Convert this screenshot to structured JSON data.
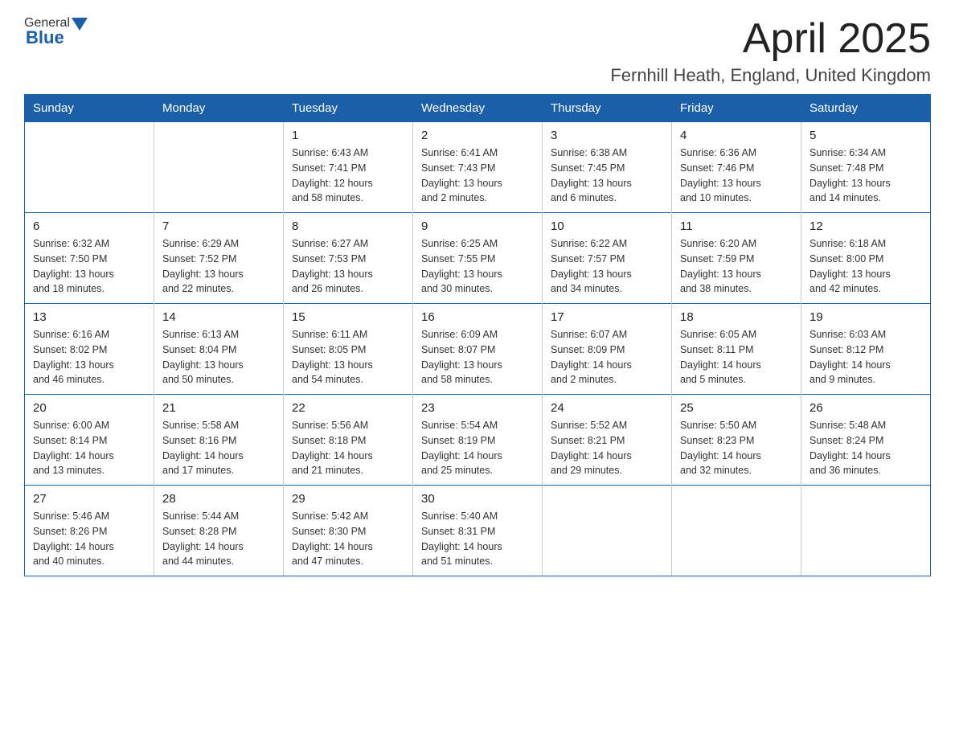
{
  "header": {
    "logo_general": "General",
    "logo_blue": "Blue",
    "month_title": "April 2025",
    "location": "Fernhill Heath, England, United Kingdom"
  },
  "weekdays": [
    "Sunday",
    "Monday",
    "Tuesday",
    "Wednesday",
    "Thursday",
    "Friday",
    "Saturday"
  ],
  "weeks": [
    [
      {
        "day": "",
        "sunrise": "",
        "sunset": "",
        "daylight": ""
      },
      {
        "day": "",
        "sunrise": "",
        "sunset": "",
        "daylight": ""
      },
      {
        "day": "1",
        "sunrise": "Sunrise: 6:43 AM",
        "sunset": "Sunset: 7:41 PM",
        "daylight": "Daylight: 12 hours and 58 minutes."
      },
      {
        "day": "2",
        "sunrise": "Sunrise: 6:41 AM",
        "sunset": "Sunset: 7:43 PM",
        "daylight": "Daylight: 13 hours and 2 minutes."
      },
      {
        "day": "3",
        "sunrise": "Sunrise: 6:38 AM",
        "sunset": "Sunset: 7:45 PM",
        "daylight": "Daylight: 13 hours and 6 minutes."
      },
      {
        "day": "4",
        "sunrise": "Sunrise: 6:36 AM",
        "sunset": "Sunset: 7:46 PM",
        "daylight": "Daylight: 13 hours and 10 minutes."
      },
      {
        "day": "5",
        "sunrise": "Sunrise: 6:34 AM",
        "sunset": "Sunset: 7:48 PM",
        "daylight": "Daylight: 13 hours and 14 minutes."
      }
    ],
    [
      {
        "day": "6",
        "sunrise": "Sunrise: 6:32 AM",
        "sunset": "Sunset: 7:50 PM",
        "daylight": "Daylight: 13 hours and 18 minutes."
      },
      {
        "day": "7",
        "sunrise": "Sunrise: 6:29 AM",
        "sunset": "Sunset: 7:52 PM",
        "daylight": "Daylight: 13 hours and 22 minutes."
      },
      {
        "day": "8",
        "sunrise": "Sunrise: 6:27 AM",
        "sunset": "Sunset: 7:53 PM",
        "daylight": "Daylight: 13 hours and 26 minutes."
      },
      {
        "day": "9",
        "sunrise": "Sunrise: 6:25 AM",
        "sunset": "Sunset: 7:55 PM",
        "daylight": "Daylight: 13 hours and 30 minutes."
      },
      {
        "day": "10",
        "sunrise": "Sunrise: 6:22 AM",
        "sunset": "Sunset: 7:57 PM",
        "daylight": "Daylight: 13 hours and 34 minutes."
      },
      {
        "day": "11",
        "sunrise": "Sunrise: 6:20 AM",
        "sunset": "Sunset: 7:59 PM",
        "daylight": "Daylight: 13 hours and 38 minutes."
      },
      {
        "day": "12",
        "sunrise": "Sunrise: 6:18 AM",
        "sunset": "Sunset: 8:00 PM",
        "daylight": "Daylight: 13 hours and 42 minutes."
      }
    ],
    [
      {
        "day": "13",
        "sunrise": "Sunrise: 6:16 AM",
        "sunset": "Sunset: 8:02 PM",
        "daylight": "Daylight: 13 hours and 46 minutes."
      },
      {
        "day": "14",
        "sunrise": "Sunrise: 6:13 AM",
        "sunset": "Sunset: 8:04 PM",
        "daylight": "Daylight: 13 hours and 50 minutes."
      },
      {
        "day": "15",
        "sunrise": "Sunrise: 6:11 AM",
        "sunset": "Sunset: 8:05 PM",
        "daylight": "Daylight: 13 hours and 54 minutes."
      },
      {
        "day": "16",
        "sunrise": "Sunrise: 6:09 AM",
        "sunset": "Sunset: 8:07 PM",
        "daylight": "Daylight: 13 hours and 58 minutes."
      },
      {
        "day": "17",
        "sunrise": "Sunrise: 6:07 AM",
        "sunset": "Sunset: 8:09 PM",
        "daylight": "Daylight: 14 hours and 2 minutes."
      },
      {
        "day": "18",
        "sunrise": "Sunrise: 6:05 AM",
        "sunset": "Sunset: 8:11 PM",
        "daylight": "Daylight: 14 hours and 5 minutes."
      },
      {
        "day": "19",
        "sunrise": "Sunrise: 6:03 AM",
        "sunset": "Sunset: 8:12 PM",
        "daylight": "Daylight: 14 hours and 9 minutes."
      }
    ],
    [
      {
        "day": "20",
        "sunrise": "Sunrise: 6:00 AM",
        "sunset": "Sunset: 8:14 PM",
        "daylight": "Daylight: 14 hours and 13 minutes."
      },
      {
        "day": "21",
        "sunrise": "Sunrise: 5:58 AM",
        "sunset": "Sunset: 8:16 PM",
        "daylight": "Daylight: 14 hours and 17 minutes."
      },
      {
        "day": "22",
        "sunrise": "Sunrise: 5:56 AM",
        "sunset": "Sunset: 8:18 PM",
        "daylight": "Daylight: 14 hours and 21 minutes."
      },
      {
        "day": "23",
        "sunrise": "Sunrise: 5:54 AM",
        "sunset": "Sunset: 8:19 PM",
        "daylight": "Daylight: 14 hours and 25 minutes."
      },
      {
        "day": "24",
        "sunrise": "Sunrise: 5:52 AM",
        "sunset": "Sunset: 8:21 PM",
        "daylight": "Daylight: 14 hours and 29 minutes."
      },
      {
        "day": "25",
        "sunrise": "Sunrise: 5:50 AM",
        "sunset": "Sunset: 8:23 PM",
        "daylight": "Daylight: 14 hours and 32 minutes."
      },
      {
        "day": "26",
        "sunrise": "Sunrise: 5:48 AM",
        "sunset": "Sunset: 8:24 PM",
        "daylight": "Daylight: 14 hours and 36 minutes."
      }
    ],
    [
      {
        "day": "27",
        "sunrise": "Sunrise: 5:46 AM",
        "sunset": "Sunset: 8:26 PM",
        "daylight": "Daylight: 14 hours and 40 minutes."
      },
      {
        "day": "28",
        "sunrise": "Sunrise: 5:44 AM",
        "sunset": "Sunset: 8:28 PM",
        "daylight": "Daylight: 14 hours and 44 minutes."
      },
      {
        "day": "29",
        "sunrise": "Sunrise: 5:42 AM",
        "sunset": "Sunset: 8:30 PM",
        "daylight": "Daylight: 14 hours and 47 minutes."
      },
      {
        "day": "30",
        "sunrise": "Sunrise: 5:40 AM",
        "sunset": "Sunset: 8:31 PM",
        "daylight": "Daylight: 14 hours and 51 minutes."
      },
      {
        "day": "",
        "sunrise": "",
        "sunset": "",
        "daylight": ""
      },
      {
        "day": "",
        "sunrise": "",
        "sunset": "",
        "daylight": ""
      },
      {
        "day": "",
        "sunrise": "",
        "sunset": "",
        "daylight": ""
      }
    ]
  ]
}
